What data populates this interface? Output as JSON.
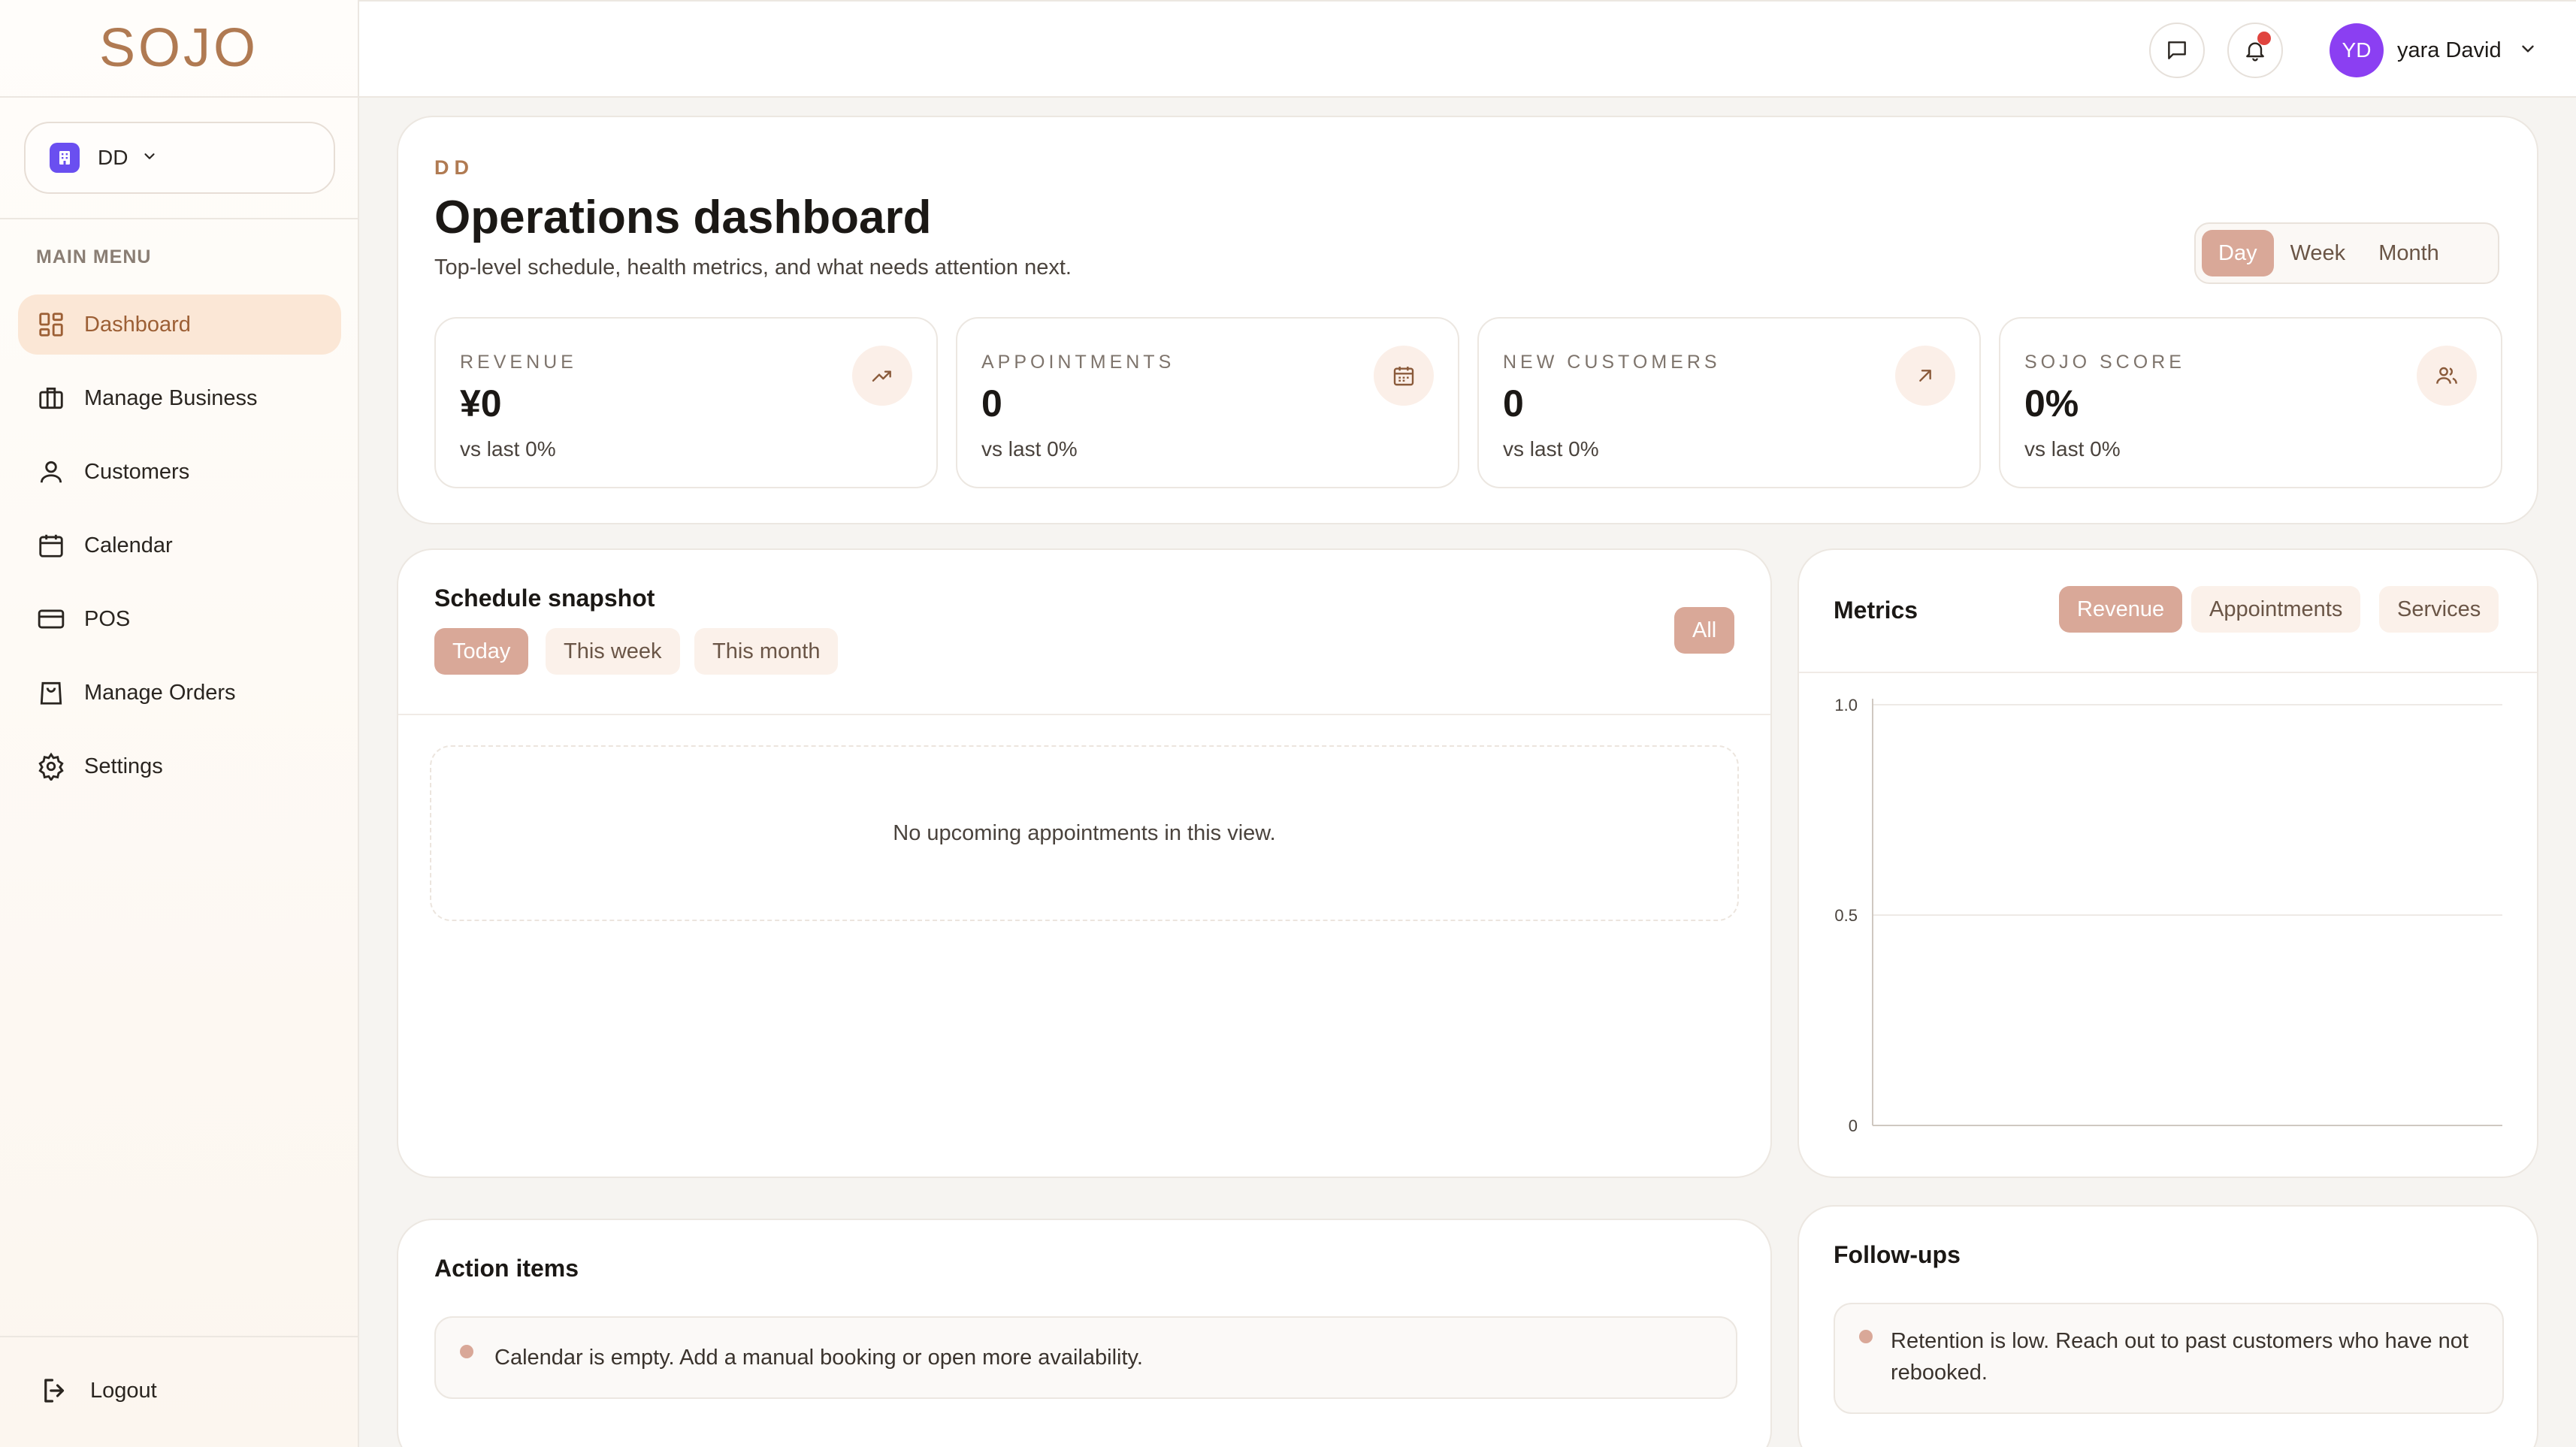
{
  "brand": {
    "logo": "SOJO"
  },
  "business_selector": {
    "label": "DD"
  },
  "sidebar": {
    "menu_title": "MAIN MENU",
    "items": [
      {
        "label": "Dashboard",
        "icon": "dashboard-icon",
        "active": true
      },
      {
        "label": "Manage Business",
        "icon": "briefcase-icon"
      },
      {
        "label": "Customers",
        "icon": "user-icon"
      },
      {
        "label": "Calendar",
        "icon": "calendar-icon"
      },
      {
        "label": "POS",
        "icon": "credit-card-icon"
      },
      {
        "label": "Manage Orders",
        "icon": "shopping-bag-icon"
      },
      {
        "label": "Settings",
        "icon": "gear-icon"
      }
    ],
    "logout_label": "Logout"
  },
  "topbar": {
    "user_initials": "YD",
    "user_name": "yara David"
  },
  "hero": {
    "kicker": "DD",
    "title": "Operations dashboard",
    "subtitle": "Top-level schedule, health metrics, and what needs attention next.",
    "period_tabs": [
      "Day",
      "Week",
      "Month"
    ],
    "active_period": "Day"
  },
  "kpis": [
    {
      "label": "REVENUE",
      "value": "¥0",
      "foot": "vs last 0%",
      "icon": "trending-up-icon"
    },
    {
      "label": "APPOINTMENTS",
      "value": "0",
      "foot": "vs last 0%",
      "icon": "calendar-icon"
    },
    {
      "label": "NEW CUSTOMERS",
      "value": "0",
      "foot": "vs last 0%",
      "icon": "arrow-up-right-icon"
    },
    {
      "label": "SOJO SCORE",
      "value": "0%",
      "foot": "vs last 0%",
      "icon": "users-icon"
    }
  ],
  "schedule": {
    "title": "Schedule snapshot",
    "tabs": [
      "Today",
      "This week",
      "This month"
    ],
    "active_tab": "Today",
    "filter_label": "All",
    "empty_text": "No upcoming appointments in this view."
  },
  "metrics": {
    "title": "Metrics",
    "tabs": [
      "Revenue",
      "Appointments",
      "Services"
    ],
    "active_tab": "Revenue"
  },
  "chart_data": {
    "type": "line",
    "x": [],
    "series": [],
    "yticks": [
      "1.0",
      "0.5",
      "0"
    ],
    "ylim": [
      0,
      1
    ],
    "grid": true
  },
  "actions": {
    "title": "Action items",
    "items": [
      "Calendar is empty. Add a manual booking or open more availability."
    ]
  },
  "followups": {
    "title": "Follow-ups",
    "items": [
      "Retention is low. Reach out to past customers who have not rebooked."
    ]
  },
  "colors": {
    "accent": "#d9a898",
    "brand": "#b07a52",
    "active_menu_bg": "#fbe7d6",
    "avatar": "#8b3ff2",
    "notification": "#e0443e"
  }
}
